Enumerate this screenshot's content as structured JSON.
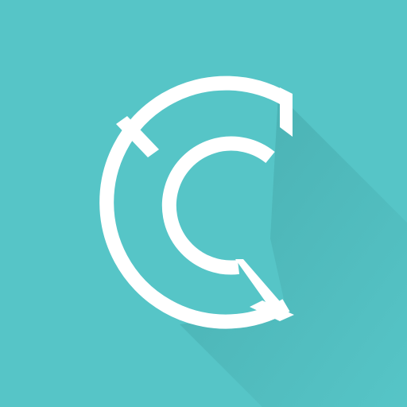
{
  "icon": {
    "name": "double-c-logo-icon",
    "colors": {
      "background": "#56c5c7",
      "shadow": "#3e9c9e",
      "mark": "#ffffff"
    }
  }
}
